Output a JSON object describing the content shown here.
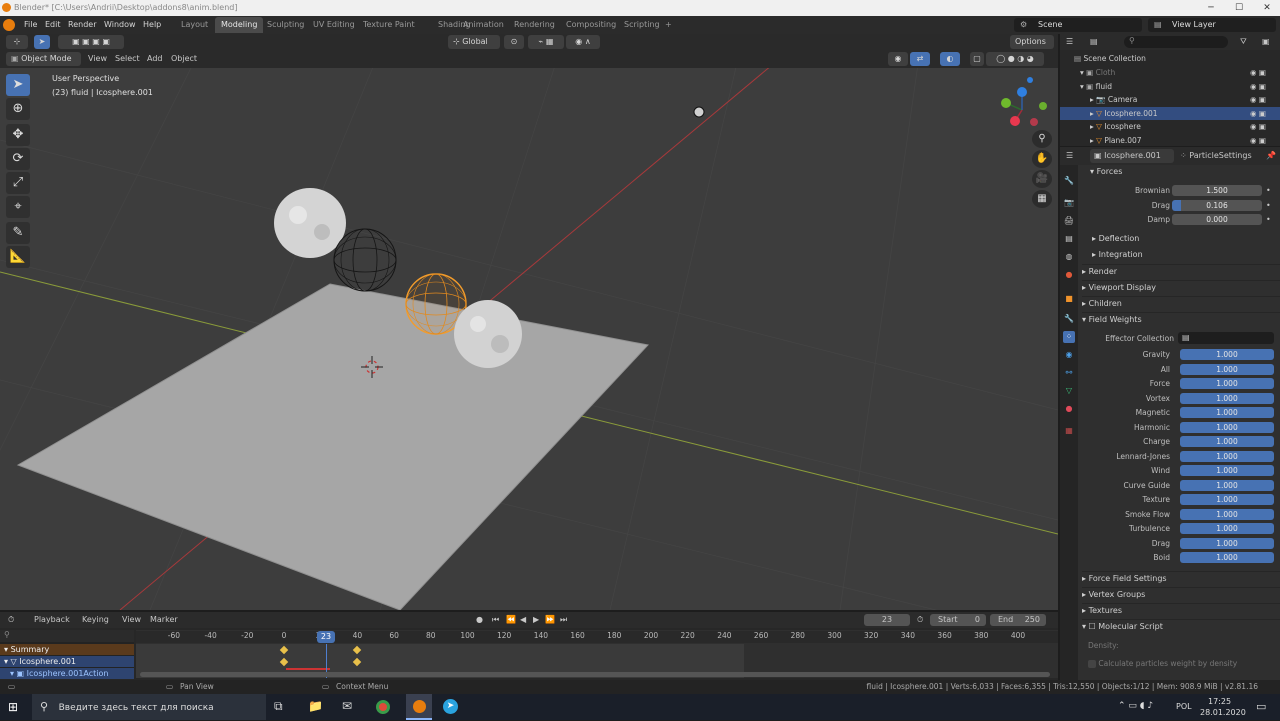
{
  "window": {
    "title": "Blender* [C:\\Users\\Andrii\\Desktop\\addons8\\anim.blend]"
  },
  "menu": {
    "file": "File",
    "edit": "Edit",
    "render": "Render",
    "window": "Window",
    "help": "Help"
  },
  "workspaces": [
    "Layout",
    "Modeling",
    "Sculpting",
    "UV Editing",
    "Texture Paint",
    "Shading",
    "Animation",
    "Rendering",
    "Compositing",
    "Scripting"
  ],
  "workspace_active": "Modeling",
  "scene": {
    "label": "Scene",
    "view_layer": "View Layer"
  },
  "toolbar": {
    "orientation": "Global",
    "options": "Options"
  },
  "viewport_header": {
    "mode": "Object Mode",
    "view": "View",
    "select": "Select",
    "add": "Add",
    "object": "Object"
  },
  "viewport": {
    "perspective": "User Perspective",
    "info": "(23) fluid | Icosphere.001"
  },
  "outliner": {
    "root": "Scene Collection",
    "items": [
      {
        "name": "Cloth",
        "indent": 1
      },
      {
        "name": "fluid",
        "indent": 1
      },
      {
        "name": "Camera",
        "indent": 2
      },
      {
        "name": "Icosphere.001",
        "indent": 2
      },
      {
        "name": "Icosphere",
        "indent": 2
      },
      {
        "name": "Plane.007",
        "indent": 2
      }
    ]
  },
  "properties": {
    "object": "Icosphere.001",
    "settings": "ParticleSettings",
    "forces_label": "Forces",
    "forces": [
      {
        "label": "Brownian",
        "value": "1.500"
      },
      {
        "label": "Drag",
        "value": "0.106"
      },
      {
        "label": "Damp",
        "value": "0.000"
      }
    ],
    "subpanels": [
      "Deflection",
      "Integration"
    ],
    "panels": [
      "Render",
      "Viewport Display",
      "Children",
      "Field Weights"
    ],
    "effector_collection": "Effector Collection",
    "weights": [
      {
        "label": "Gravity",
        "value": "1.000"
      },
      {
        "label": "All",
        "value": "1.000"
      },
      {
        "label": "Force",
        "value": "1.000"
      },
      {
        "label": "Vortex",
        "value": "1.000"
      },
      {
        "label": "Magnetic",
        "value": "1.000"
      },
      {
        "label": "Harmonic",
        "value": "1.000"
      },
      {
        "label": "Charge",
        "value": "1.000"
      },
      {
        "label": "Lennard-Jones",
        "value": "1.000"
      },
      {
        "label": "Wind",
        "value": "1.000"
      },
      {
        "label": "Curve Guide",
        "value": "1.000"
      },
      {
        "label": "Texture",
        "value": "1.000"
      },
      {
        "label": "Smoke Flow",
        "value": "1.000"
      },
      {
        "label": "Turbulence",
        "value": "1.000"
      },
      {
        "label": "Drag",
        "value": "1.000"
      },
      {
        "label": "Boid",
        "value": "1.000"
      }
    ],
    "bottom_panels": [
      "Force Field Settings",
      "Vertex Groups",
      "Textures",
      "Molecular Script"
    ],
    "density_label": "Density:",
    "density_checkbox": "Calculate particles weight by density"
  },
  "timeline": {
    "playback": "Playback",
    "keying": "Keying",
    "view": "View",
    "marker": "Marker",
    "current_frame": "23",
    "start_label": "Start",
    "start": "0",
    "end_label": "End",
    "end": "250",
    "ticks": [
      "-60",
      "-40",
      "-20",
      "0",
      "20",
      "40",
      "60",
      "80",
      "100",
      "120",
      "140",
      "160",
      "180",
      "200",
      "220",
      "240",
      "260",
      "280",
      "300",
      "320",
      "340",
      "360",
      "380",
      "400"
    ],
    "playhead": "23",
    "channels": [
      "Summary",
      "Icosphere.001",
      "Icosphere.001Action"
    ]
  },
  "status": {
    "pan": "Pan View",
    "context": "Context Menu",
    "stats": "fluid | Icosphere.001 | Verts:6,033 | Faces:6,355 | Tris:12,550 | Objects:1/12 | Mem: 908.9 MiB | v2.81.16"
  },
  "taskbar": {
    "search": "Введите здесь текст для поиска",
    "lang": "POL",
    "time": "17:25",
    "date": "28.01.2020"
  }
}
